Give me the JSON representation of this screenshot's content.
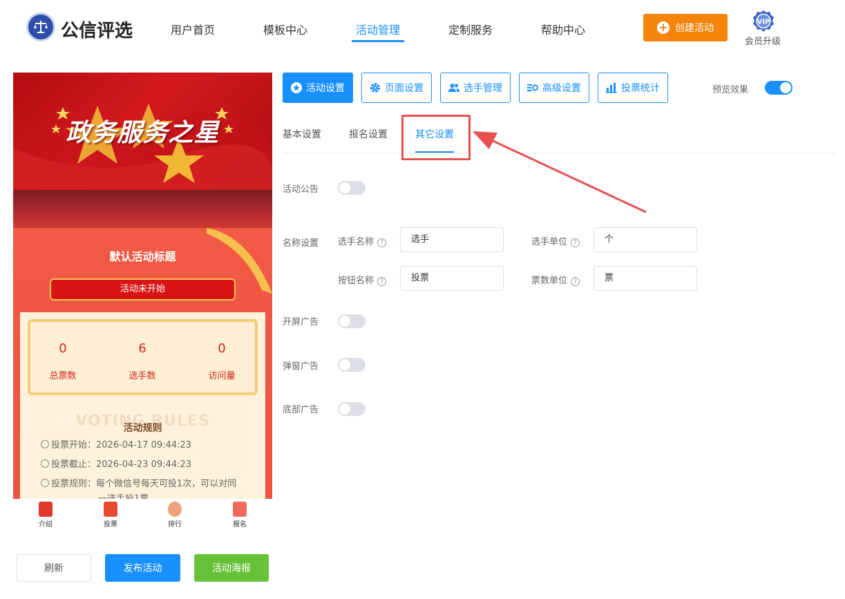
{
  "header": {
    "brand": "公信评选",
    "nav": [
      "用户首页",
      "模板中心",
      "活动管理",
      "定制服务",
      "帮助中心"
    ],
    "active_nav": 2,
    "create_label": "创建活动",
    "vip_badge": "VIP",
    "vip_label": "会员升级"
  },
  "preview": {
    "banner_title": "政务服务之星",
    "activity_title": "默认活动标题",
    "status": "活动未开始",
    "stats": [
      {
        "value": "0",
        "label": "总票数"
      },
      {
        "value": "6",
        "label": "选手数"
      },
      {
        "value": "0",
        "label": "访问量"
      }
    ],
    "rules_watermark": "VOTING RULES",
    "rules_title": "活动规则",
    "rules": [
      "投票开始：2026-04-17 09:44:23",
      "投票截止：2026-04-23 09:44:23",
      "投票规则：每个微信号每天可投1次，可以对同",
      "一选手投1票"
    ],
    "tabbar": [
      "介绍",
      "投票",
      "排行",
      "报名"
    ]
  },
  "actions": {
    "refresh": "刷新",
    "publish": "发布活动",
    "poster": "活动海报"
  },
  "toolbar": {
    "buttons": [
      "活动设置",
      "页面设置",
      "选手管理",
      "高级设置",
      "投票统计"
    ],
    "preview_label": "预览效果"
  },
  "subtabs": [
    "基本设置",
    "报名设置",
    "其它设置"
  ],
  "form": {
    "notice_label": "活动公告",
    "name_label": "名称设置",
    "player_name_label": "选手名称",
    "player_name_value": "选手",
    "player_unit_label": "选手单位",
    "player_unit_value": "个",
    "button_name_label": "按钮名称",
    "button_name_value": "投票",
    "vote_unit_label": "票数单位",
    "vote_unit_value": "票",
    "splash_ad_label": "开屏广告",
    "popup_ad_label": "弹窗广告",
    "bottom_ad_label": "底部广告"
  },
  "colors": {
    "accent": "#1890ff",
    "create": "#f5840c",
    "poster": "#67c23a",
    "highlight": "#e84f4f"
  }
}
